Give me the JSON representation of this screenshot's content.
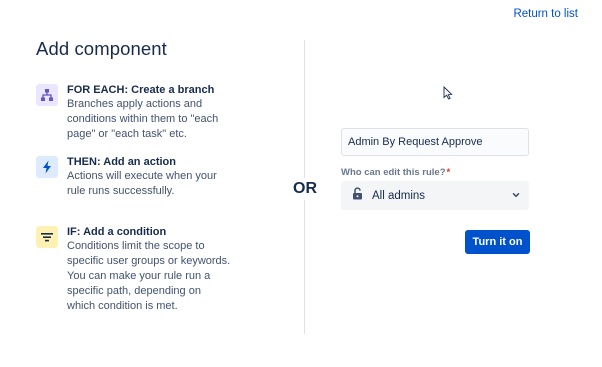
{
  "header": {
    "return_link": "Return to list"
  },
  "left": {
    "title": "Add component",
    "components": [
      {
        "icon": "branch-icon",
        "title": "FOR EACH: Create a branch",
        "description": "Branches apply actions and\nconditions within them to \"each\npage\" or \"each task\" etc."
      },
      {
        "icon": "lightning-icon",
        "title": "THEN: Add an action",
        "description": "Actions will execute when your\nrule runs successfully."
      },
      {
        "icon": "filter-icon",
        "title": "IF: Add a condition",
        "description": "Conditions limit the scope to\nspecific user groups or keywords.\nYou can make your rule run a\nspecific path, depending on\nwhich condition is met."
      }
    ]
  },
  "separator": {
    "label": "OR"
  },
  "form": {
    "rule_name_value": "Admin By Request Approve",
    "edit_label": "Who can edit this rule?",
    "required_marker": "*",
    "edit_select_icon": "lock-icon",
    "edit_select_value": "All admins",
    "submit_label": "Turn it on"
  },
  "colors": {
    "primary": "#0052cc",
    "branch_bg": "#eae6ff",
    "action_bg": "#deebff",
    "condition_bg": "#fff0b3"
  }
}
